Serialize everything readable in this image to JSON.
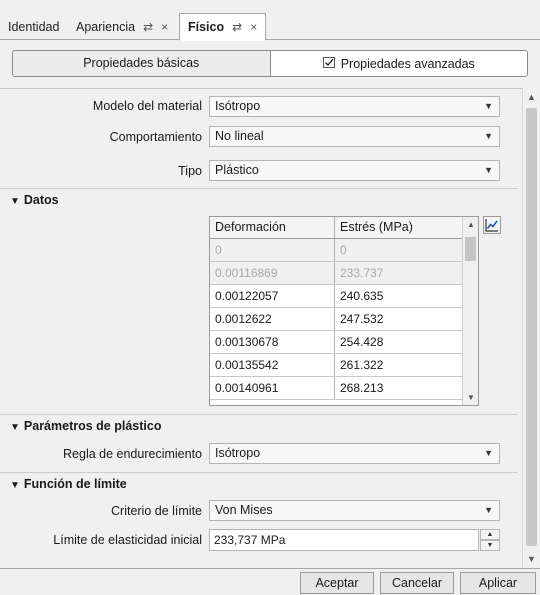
{
  "tabs": [
    {
      "label": "Identidad",
      "active": false
    },
    {
      "label": "Apariencia",
      "active": false,
      "icons": [
        "swap-icon",
        "close-icon"
      ]
    },
    {
      "label": "Físico",
      "active": true,
      "icons": [
        "swap-icon",
        "close-icon"
      ]
    }
  ],
  "tab_icons": {
    "swap": "⇄",
    "close": "×"
  },
  "segment": {
    "basic_label": "Propiedades básicas",
    "advanced_label": "Propiedades avanzadas",
    "advanced_checked": true
  },
  "material": {
    "model_label": "Modelo del material",
    "model_value": "Isótropo",
    "behavior_label": "Comportamiento",
    "behavior_value": "No lineal",
    "type_label": "Tipo",
    "type_value": "Plástico"
  },
  "datos": {
    "title": "Datos",
    "columns": [
      "Deformación",
      "Estrés (MPa)"
    ],
    "rows": [
      {
        "strain": "0",
        "stress": "0",
        "readonly": true
      },
      {
        "strain": "0.00116869",
        "stress": "233.737",
        "readonly": true
      },
      {
        "strain": "0.00122057",
        "stress": "240.635",
        "readonly": false
      },
      {
        "strain": "0.0012622",
        "stress": "247.532",
        "readonly": false
      },
      {
        "strain": "0.00130678",
        "stress": "254.428",
        "readonly": false
      },
      {
        "strain": "0.00135542",
        "stress": "261.322",
        "readonly": false
      },
      {
        "strain": "0.00140961",
        "stress": "268.213",
        "readonly": false
      }
    ],
    "chart_button_icon": "line-chart-icon"
  },
  "plastico": {
    "title": "Parámetros de plástico",
    "hardening_label": "Regla de endurecimiento",
    "hardening_value": "Isótropo"
  },
  "limite": {
    "title": "Función de límite",
    "criterion_label": "Criterio de límite",
    "criterion_value": "Von Mises",
    "yield_label": "Límite de elasticidad inicial",
    "yield_value": "233,737 MPa"
  },
  "footer": {
    "accept_label": "Aceptar",
    "cancel_label": "Cancelar",
    "apply_label": "Aplicar"
  }
}
